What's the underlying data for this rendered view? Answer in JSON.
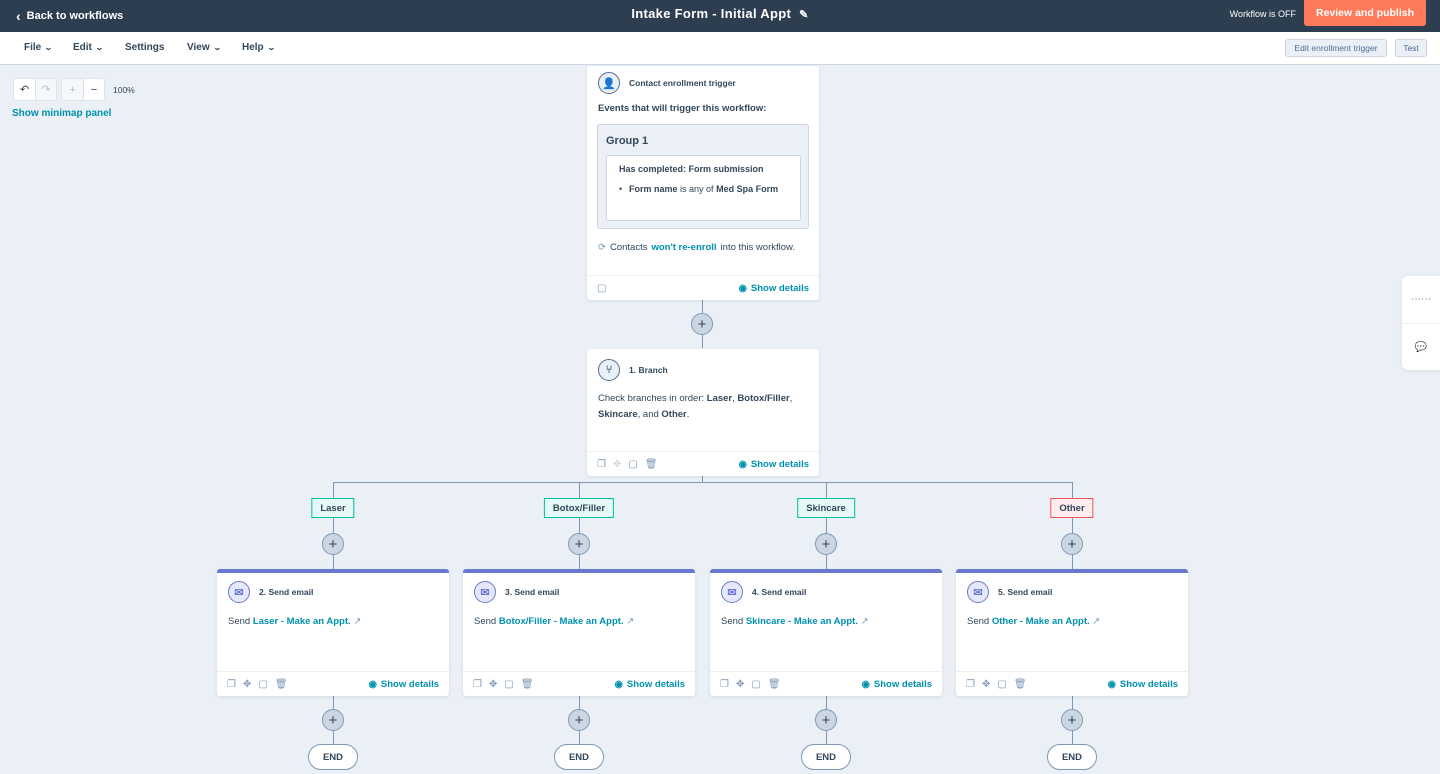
{
  "topbar": {
    "back_label": "Back to workflows",
    "title": "Intake Form - Initial Appt",
    "status": "Workflow is OFF",
    "publish_label": "Review and publish"
  },
  "menubar": {
    "items": [
      {
        "label": "File"
      },
      {
        "label": "Edit"
      },
      {
        "label": "Settings"
      },
      {
        "label": "View"
      },
      {
        "label": "Help"
      }
    ],
    "edit_trigger_label": "Edit enrollment trigger",
    "test_label": "Test"
  },
  "canvas": {
    "zoom_level": "100%",
    "minimap_label": "Show minimap panel"
  },
  "trigger": {
    "title": "Contact enrollment trigger",
    "events_label": "Events that will trigger this workflow:",
    "group_title": "Group 1",
    "filter_title": "Has completed: Form submission",
    "filter_field": "Form name",
    "filter_op": "is any of",
    "filter_value": "Med Spa Form",
    "reenroll_pre": "Contacts",
    "reenroll_link": "won't re-enroll",
    "reenroll_post": "into this workflow.",
    "show_details": "Show details"
  },
  "branch": {
    "title": "1. Branch",
    "text_pre": "Check branches in order:",
    "b1": "Laser",
    "b2": "Botox/Filler",
    "b3": "Skincare",
    "and": "and",
    "b4": "Other",
    "show_details": "Show details"
  },
  "branches": [
    {
      "label": "Laser",
      "step": "2. Send email",
      "send": "Send",
      "email": "Laser - Make an Appt.",
      "show_details": "Show details",
      "end": "END"
    },
    {
      "label": "Botox/Filler",
      "step": "3. Send email",
      "send": "Send",
      "email": "Botox/Filler - Make an Appt.",
      "show_details": "Show details",
      "end": "END"
    },
    {
      "label": "Skincare",
      "step": "4. Send email",
      "send": "Send",
      "email": "Skincare - Make an Appt.",
      "show_details": "Show details",
      "end": "END"
    },
    {
      "label": "Other",
      "step": "5. Send email",
      "send": "Send",
      "email": "Other - Make an Appt.",
      "show_details": "Show details",
      "end": "END"
    }
  ],
  "colors": {
    "accent": "#0091ae",
    "publish": "#ff7a59",
    "email_bar": "#6a78d1",
    "branch_tag": "#00bda5",
    "other_tag": "#f2545b"
  }
}
